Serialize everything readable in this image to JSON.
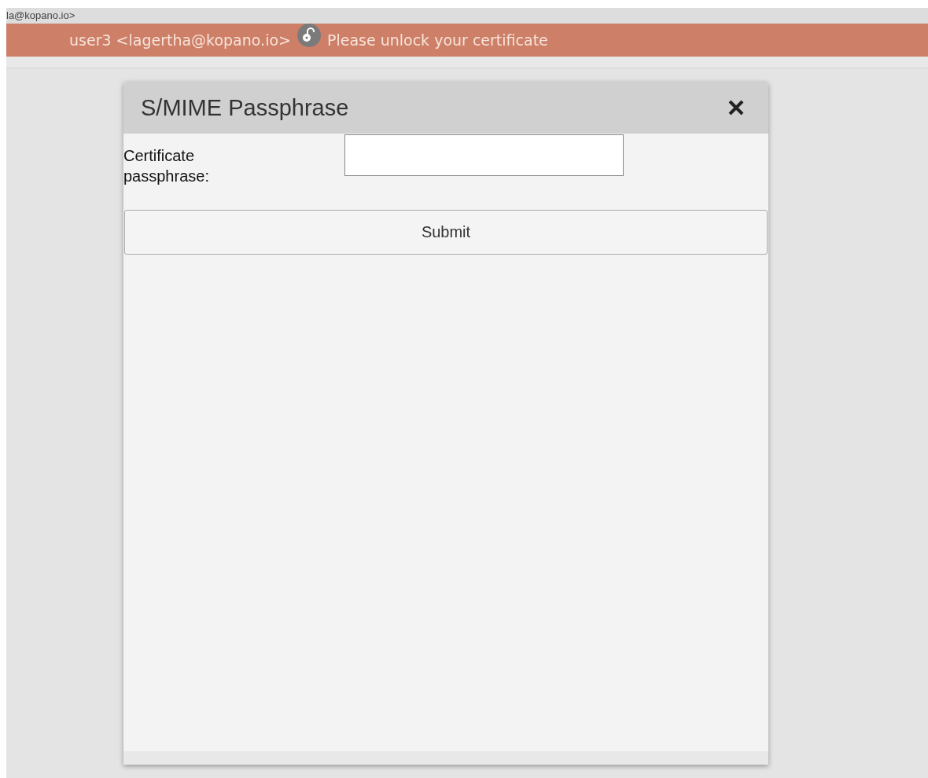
{
  "header_strip": {
    "text": "la@kopano.io>"
  },
  "notice_bar": {
    "sender": "user3 <lagertha@kopano.io>",
    "message": "Please unlock your certificate"
  },
  "dialog": {
    "title": "S/MIME Passphrase",
    "field_label": "Certificate passphrase:",
    "submit_label": "Submit"
  }
}
